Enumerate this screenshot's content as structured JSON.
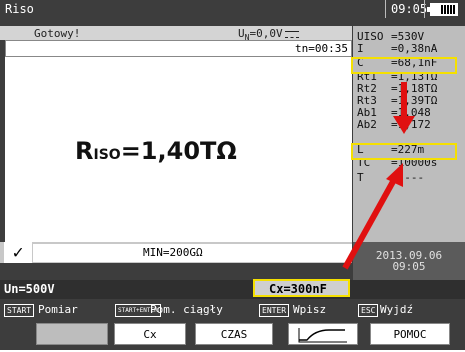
{
  "header": {
    "title": "Riso",
    "time": "09:05"
  },
  "status": {
    "text": "Gotowy!",
    "un": "U",
    "un_sub": "N",
    "un_value": "=0,0V"
  },
  "tn": "tn=00:35",
  "result": {
    "label_main": "R",
    "label_sub": "ISO",
    "value": "=1,40TΩ"
  },
  "min_text": "MIN=200GΩ",
  "un_setting": "Un=500V",
  "cx_setting": "Cx=300nF",
  "side": [
    {
      "k": "UISO",
      "v": "=530V"
    },
    {
      "k": "I",
      "v": "=0,38nA"
    },
    {
      "k": "C",
      "v": "=68,1nF"
    },
    {
      "k": "Rt1",
      "v": "=1,13TΩ"
    },
    {
      "k": "Rt2",
      "v": "=1,18TΩ"
    },
    {
      "k": "Rt3",
      "v": "=1,39TΩ"
    },
    {
      "k": "Ab1",
      "v": "=1,048"
    },
    {
      "k": "Ab2",
      "v": "=1,172"
    },
    {
      "k": "L",
      "v": "=227m"
    },
    {
      "k": "TC",
      "v": "=10000s"
    },
    {
      "k": "T",
      "v": "=----"
    }
  ],
  "date": {
    "d": "2013.09.06",
    "t": "09:05"
  },
  "legend": [
    {
      "key": "START",
      "label": "Pomiar"
    },
    {
      "key": "START+ENTER",
      "label": "Pom. ciągły"
    },
    {
      "key": "ENTER",
      "label": "Wpisz"
    },
    {
      "key": "ESC",
      "label": "Wyjdź"
    }
  ],
  "fkeys": [
    "",
    "Cx",
    "CZAS",
    "",
    "POMOC"
  ],
  "colors": {
    "highlight": "#f5e000",
    "arrow": "#e01010"
  }
}
